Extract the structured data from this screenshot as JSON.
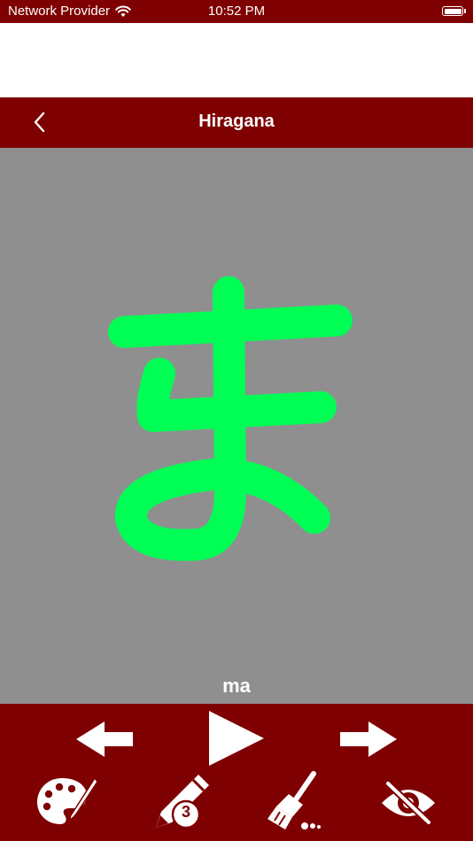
{
  "status_bar": {
    "carrier": "Network Provider",
    "time": "10:52 PM"
  },
  "nav": {
    "title": "Hiragana",
    "back_icon": "chevron-left-icon"
  },
  "canvas": {
    "stroke_color": "#00ff55",
    "background_color": "#8f8f8f"
  },
  "character": {
    "romaji": "ma"
  },
  "toolbar": {
    "prev_icon": "arrow-left-icon",
    "play_icon": "play-icon",
    "next_icon": "arrow-right-icon",
    "palette_icon": "palette-icon",
    "pen_size": "3",
    "clear_icon": "broom-icon",
    "hide_icon": "eye-slash-icon"
  },
  "colors": {
    "brand": "#7f0000",
    "icon": "#ffffff"
  }
}
